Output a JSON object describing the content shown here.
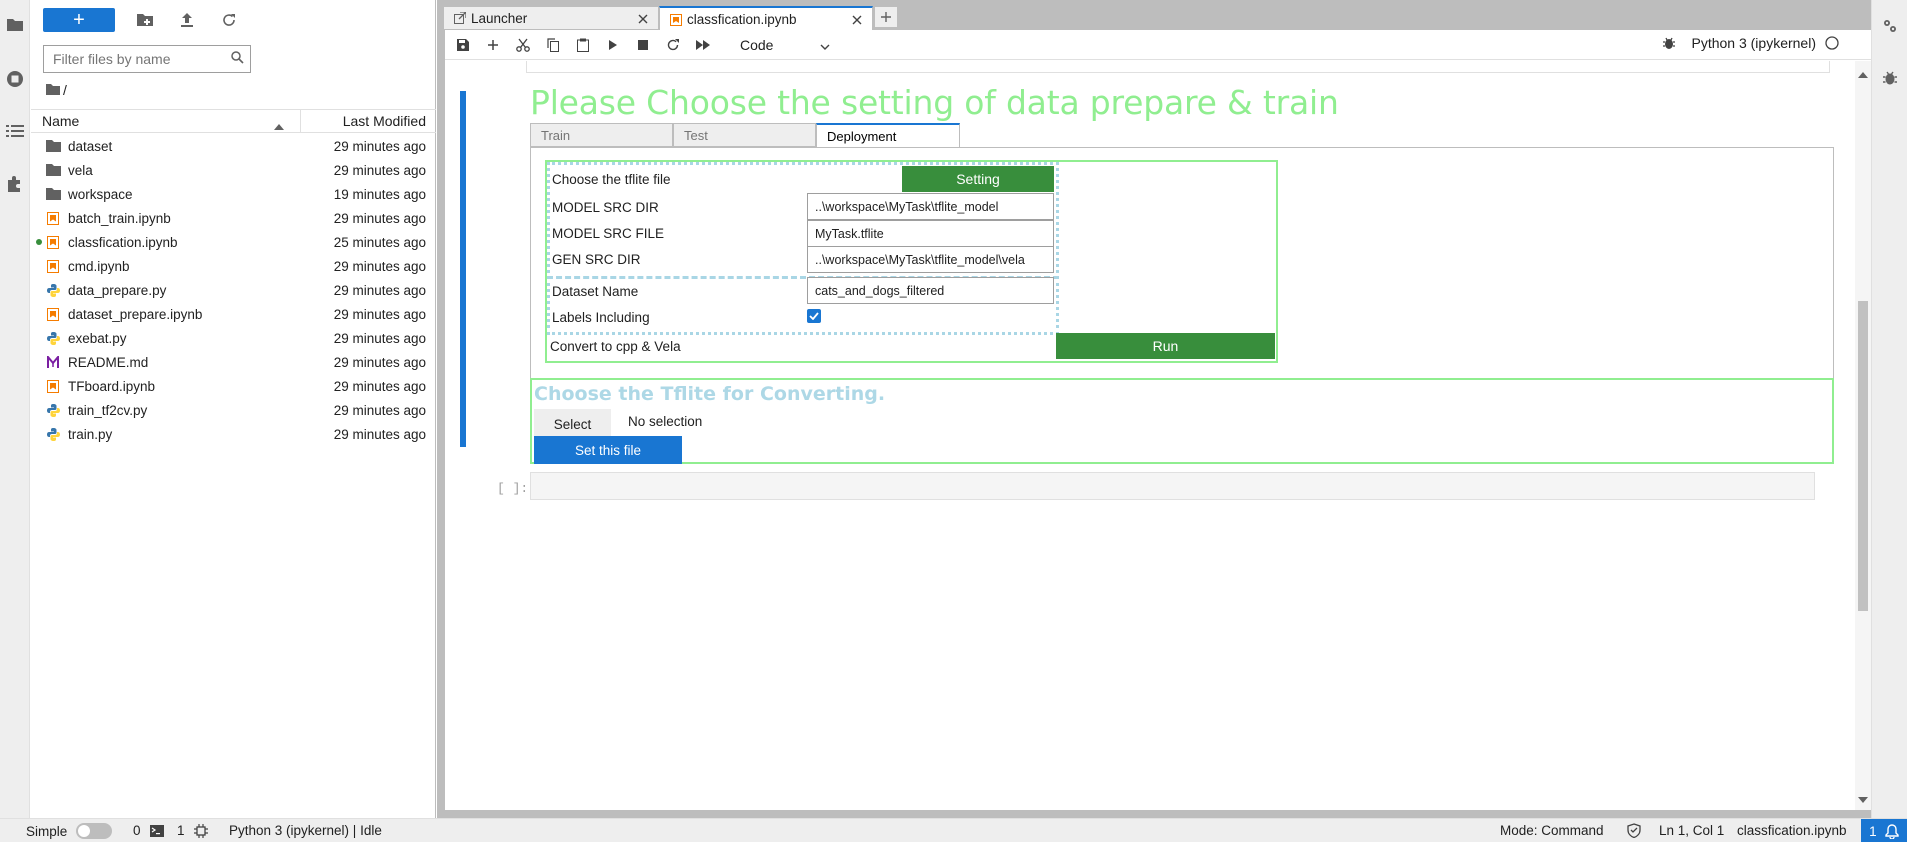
{
  "file_browser": {
    "new_label": "+",
    "search_placeholder": "Filter files by name",
    "breadcrumb": "/",
    "col_name": "Name",
    "col_modified": "Last Modified",
    "files": [
      {
        "name": "dataset",
        "modified": "29 minutes ago",
        "type": "folder",
        "running": false
      },
      {
        "name": "vela",
        "modified": "29 minutes ago",
        "type": "folder",
        "running": false
      },
      {
        "name": "workspace",
        "modified": "19 minutes ago",
        "type": "folder",
        "running": false
      },
      {
        "name": "batch_train.ipynb",
        "modified": "29 minutes ago",
        "type": "notebook",
        "running": false
      },
      {
        "name": "classfication.ipynb",
        "modified": "25 minutes ago",
        "type": "notebook",
        "running": true
      },
      {
        "name": "cmd.ipynb",
        "modified": "29 minutes ago",
        "type": "notebook",
        "running": false
      },
      {
        "name": "data_prepare.py",
        "modified": "29 minutes ago",
        "type": "python",
        "running": false
      },
      {
        "name": "dataset_prepare.ipynb",
        "modified": "29 minutes ago",
        "type": "notebook",
        "running": false
      },
      {
        "name": "exebat.py",
        "modified": "29 minutes ago",
        "type": "python",
        "running": false
      },
      {
        "name": "README.md",
        "modified": "29 minutes ago",
        "type": "markdown",
        "running": false
      },
      {
        "name": "TFboard.ipynb",
        "modified": "29 minutes ago",
        "type": "notebook",
        "running": false
      },
      {
        "name": "train_tf2cv.py",
        "modified": "29 minutes ago",
        "type": "python",
        "running": false
      },
      {
        "name": "train.py",
        "modified": "29 minutes ago",
        "type": "python",
        "running": false
      }
    ]
  },
  "tabs": [
    {
      "label": "Launcher",
      "icon": "launcher-icon"
    },
    {
      "label": "classfication.ipynb",
      "icon": "notebook-icon"
    }
  ],
  "toolbar": {
    "cell_type": "Code",
    "kernel_name": "Python 3 (ipykernel)"
  },
  "notebook": {
    "heading": "Please Choose the setting of data prepare & train",
    "widget_tabs": [
      "Train",
      "Test",
      "Deployment"
    ],
    "active_widget_tab": "Deployment",
    "deployment": {
      "choose_tflite_label": "Choose the tflite file",
      "setting_button": "Setting",
      "model_src_dir_label": "MODEL SRC DIR",
      "model_src_dir_value": "..\\workspace\\MyTask\\tflite_model",
      "model_src_file_label": "MODEL SRC FILE",
      "model_src_file_value": "MyTask.tflite",
      "gen_src_dir_label": "GEN SRC DIR",
      "gen_src_dir_value": "..\\workspace\\MyTask\\tflite_model\\vela",
      "dataset_name_label": "Dataset Name",
      "dataset_name_value": "cats_and_dogs_filtered",
      "labels_including_label": "Labels Including",
      "labels_including_checked": true,
      "convert_label": "Convert to cpp & Vela",
      "run_button": "Run"
    },
    "converter": {
      "title": "Choose the Tflite for Converting.",
      "select_button": "Select",
      "selection_status": "No selection",
      "set_file_button": "Set this file"
    },
    "empty_cell_prompt": "[ ]:"
  },
  "status_bar": {
    "mode_label": "Simple",
    "terminals_count": "0",
    "kernels_count": "1",
    "kernel_status": "Python 3 (ipykernel) | Idle",
    "mode": "Mode: Command",
    "cursor": "Ln 1, Col 1",
    "filename": "classfication.ipynb",
    "notifications": "1"
  },
  "colors": {
    "accent": "#1976d2",
    "green_button": "#388e3c",
    "heading_green": "#90ee90",
    "converter_title": "#add8e6"
  }
}
